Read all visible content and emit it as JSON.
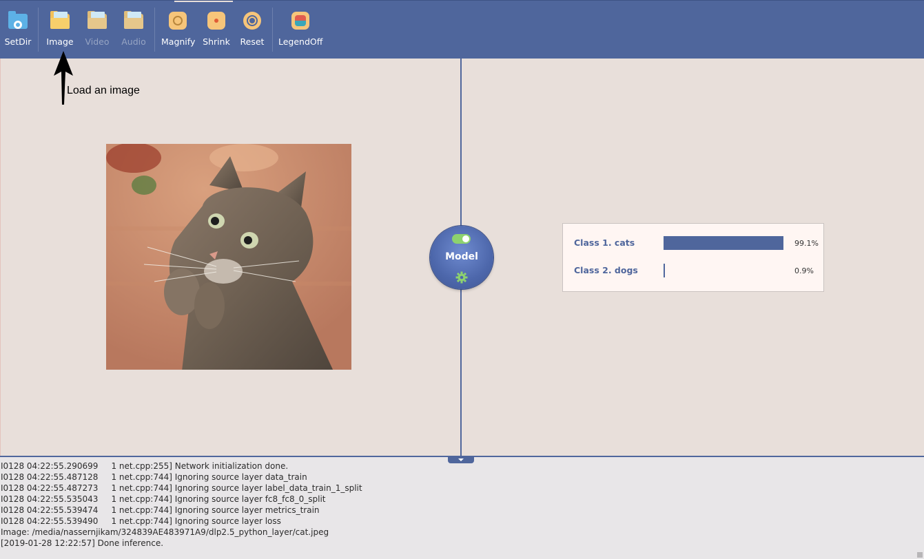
{
  "toolbar": {
    "items": [
      {
        "label": "SetDir",
        "icon": "folder-settings-icon",
        "enabled": true
      },
      {
        "label": "Image",
        "icon": "folder-image-icon",
        "enabled": true
      },
      {
        "label": "Video",
        "icon": "folder-video-icon",
        "enabled": false
      },
      {
        "label": "Audio",
        "icon": "folder-audio-icon",
        "enabled": false
      },
      {
        "label": "Magnify",
        "icon": "magnify-icon",
        "enabled": true
      },
      {
        "label": "Shrink",
        "icon": "shrink-icon",
        "enabled": true
      },
      {
        "label": "Reset",
        "icon": "reset-icon",
        "enabled": true
      },
      {
        "label": "LegendOff",
        "icon": "legend-icon",
        "enabled": true
      }
    ]
  },
  "annotation": {
    "text": "Load an image"
  },
  "model": {
    "label": "Model",
    "enabled": true
  },
  "results": [
    {
      "label": "Class 1. cats",
      "value": 0.991,
      "pct": "99.1%"
    },
    {
      "label": "Class 2. dogs",
      "value": 0.009,
      "pct": "0.9%"
    }
  ],
  "log": [
    "I0128 04:22:55.290699     1 net.cpp:255] Network initialization done.",
    "I0128 04:22:55.487128     1 net.cpp:744] Ignoring source layer data_train",
    "I0128 04:22:55.487273     1 net.cpp:744] Ignoring source layer label_data_train_1_split",
    "I0128 04:22:55.535043     1 net.cpp:744] Ignoring source layer fc8_fc8_0_split",
    "I0128 04:22:55.539474     1 net.cpp:744] Ignoring source layer metrics_train",
    "I0128 04:22:55.539490     1 net.cpp:744] Ignoring source layer loss",
    "Image: /media/nassernjikam/324839AE483971A9/dlp2.5_python_layer/cat.jpeg",
    "[2019-01-28 12:22:57] Done inference."
  ],
  "colors": {
    "accent": "#4f669c",
    "background": "#e8dfda",
    "toggle_on": "#8dd26e"
  }
}
